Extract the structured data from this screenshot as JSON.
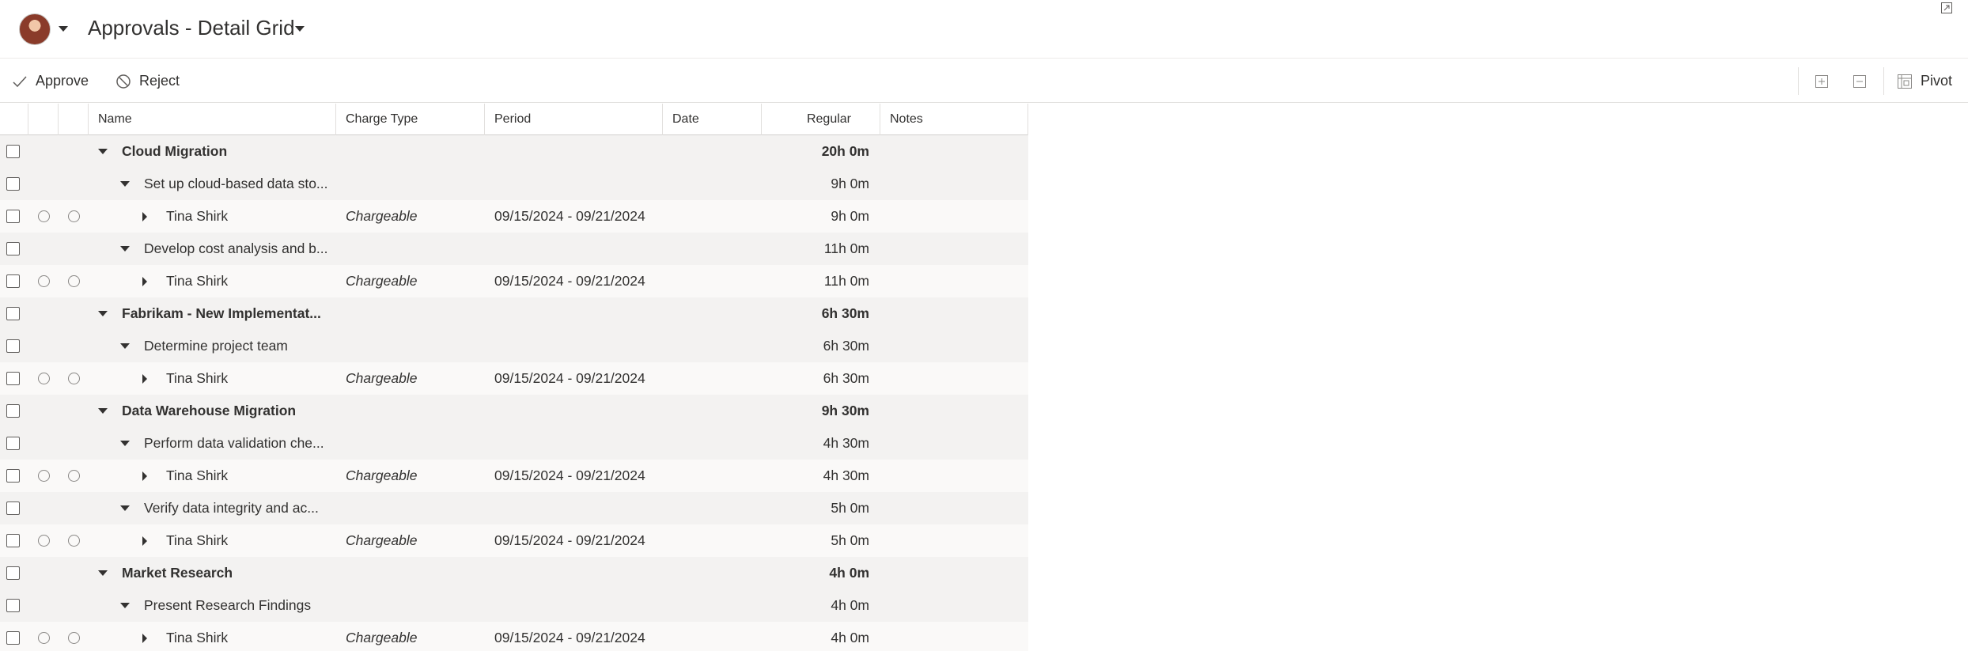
{
  "header": {
    "title": "Approvals - Detail Grid"
  },
  "toolbar": {
    "approve_label": "Approve",
    "reject_label": "Reject",
    "pivot_label": "Pivot"
  },
  "columns": {
    "name": "Name",
    "charge_type": "Charge Type",
    "period": "Period",
    "date": "Date",
    "regular": "Regular",
    "notes": "Notes"
  },
  "rows": [
    {
      "level": "group",
      "name": "Cloud Migration",
      "charge_type": "",
      "period": "",
      "regular": "20h 0m"
    },
    {
      "level": "task",
      "name": "Set up cloud-based data sto...",
      "charge_type": "",
      "period": "",
      "regular": "9h 0m"
    },
    {
      "level": "entry",
      "name": "Tina Shirk",
      "charge_type": "Chargeable",
      "period": "09/15/2024 - 09/21/2024",
      "regular": "9h 0m"
    },
    {
      "level": "task",
      "name": "Develop cost analysis and b...",
      "charge_type": "",
      "period": "",
      "regular": "11h 0m"
    },
    {
      "level": "entry",
      "name": "Tina Shirk",
      "charge_type": "Chargeable",
      "period": "09/15/2024 - 09/21/2024",
      "regular": "11h 0m"
    },
    {
      "level": "group",
      "name": "Fabrikam - New Implementat...",
      "charge_type": "",
      "period": "",
      "regular": "6h 30m"
    },
    {
      "level": "task",
      "name": "Determine project team",
      "charge_type": "",
      "period": "",
      "regular": "6h 30m"
    },
    {
      "level": "entry",
      "name": "Tina Shirk",
      "charge_type": "Chargeable",
      "period": "09/15/2024 - 09/21/2024",
      "regular": "6h 30m"
    },
    {
      "level": "group",
      "name": "Data Warehouse Migration",
      "charge_type": "",
      "period": "",
      "regular": "9h 30m"
    },
    {
      "level": "task",
      "name": "Perform data validation che...",
      "charge_type": "",
      "period": "",
      "regular": "4h 30m"
    },
    {
      "level": "entry",
      "name": "Tina Shirk",
      "charge_type": "Chargeable",
      "period": "09/15/2024 - 09/21/2024",
      "regular": "4h 30m"
    },
    {
      "level": "task",
      "name": "Verify data integrity and ac...",
      "charge_type": "",
      "period": "",
      "regular": "5h 0m"
    },
    {
      "level": "entry",
      "name": "Tina Shirk",
      "charge_type": "Chargeable",
      "period": "09/15/2024 - 09/21/2024",
      "regular": "5h 0m"
    },
    {
      "level": "group",
      "name": "Market Research",
      "charge_type": "",
      "period": "",
      "regular": "4h 0m"
    },
    {
      "level": "task",
      "name": "Present Research Findings",
      "charge_type": "",
      "period": "",
      "regular": "4h 0m"
    },
    {
      "level": "entry",
      "name": "Tina Shirk",
      "charge_type": "Chargeable",
      "period": "09/15/2024 - 09/21/2024",
      "regular": "4h 0m"
    }
  ]
}
